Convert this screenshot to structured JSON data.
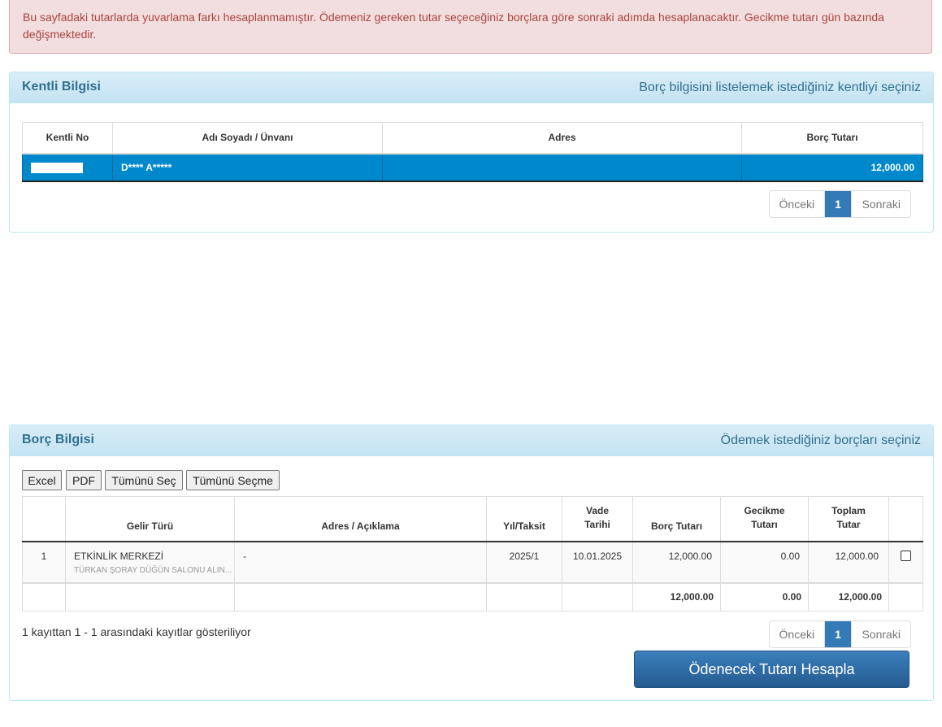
{
  "alert": {
    "text": "Bu sayfadaki tutarlarda yuvarlama farkı hesaplanmamıştır. Ödemeniz gereken tutar seçeceğiniz borçlara göre sonraki adımda hesaplanacaktır. Gecikme tutarı gün bazında değişmektedir."
  },
  "kentli": {
    "title": "Kentli Bilgisi",
    "hint": "Borç bilgisini listelemek istediğiniz kentliyi seçiniz",
    "columns": [
      "Kentli No",
      "Adı Soyadı / Ünvanı",
      "Adres",
      "Borç Tutarı"
    ],
    "row": {
      "kentli_no": "",
      "name": "D**** A*****",
      "address": "",
      "amount": "12,000.00"
    },
    "pager": {
      "prev": "Önceki",
      "current": "1",
      "next": "Sonraki"
    }
  },
  "borc": {
    "title": "Borç Bilgisi",
    "hint": "Ödemek istediğiniz borçları seçiniz",
    "buttons": {
      "excel": "Excel",
      "pdf": "PDF",
      "select_all": "Tümünü Seç",
      "deselect_all": "Tümünü Seçme"
    },
    "columns": {
      "gelir": "Gelir Türü",
      "adres": "Adres / Açıklama",
      "yil": "Yıl/Taksit",
      "vade1": "Vade",
      "vade2": "Tarihi",
      "borc": "Borç Tutarı",
      "gecikme1": "Gecikme",
      "gecikme2": "Tutarı",
      "toplam1": "Toplam",
      "toplam2": "Tutar"
    },
    "row": {
      "no": "1",
      "gelir": "ETKİNLİK MERKEZİ",
      "gelir_sub": "TÜRKAN ŞORAY DÜĞÜN SALONU ALIN...",
      "adres": "-",
      "yil": "2025/1",
      "vade": "10.01.2025",
      "borc": "12,000.00",
      "gecikme": "0.00",
      "toplam": "12,000.00"
    },
    "totals": {
      "borc": "12,000.00",
      "gecikme": "0.00",
      "toplam": "12,000.00"
    },
    "info": "1 kayıttan 1 - 1 arasındaki kayıtlar gösteriliyor",
    "pager": {
      "prev": "Önceki",
      "current": "1",
      "next": "Sonraki"
    },
    "calc_button": "Ödenecek Tutarı Hesapla"
  },
  "colors": {
    "selected_row": "#0088cc",
    "primary": "#337ab7",
    "heading_text": "#31708f"
  }
}
